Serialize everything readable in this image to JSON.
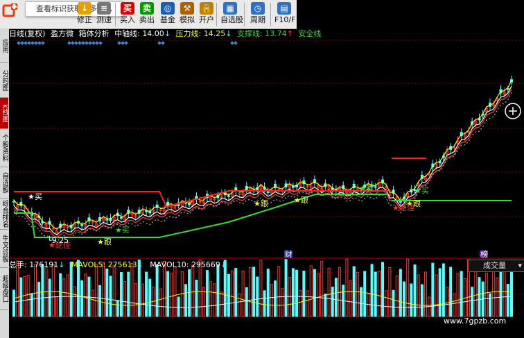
{
  "toolbar": {
    "tooltip": "查看标识获取更多信息",
    "buttons": [
      {
        "label": "修正",
        "icon": "↓",
        "color": "#e8a000"
      },
      {
        "label": "测速",
        "icon": "≡",
        "color": "#777"
      },
      {
        "label": "买入",
        "icon": "买",
        "color": "#d00"
      },
      {
        "label": "卖出",
        "icon": "卖",
        "color": "#090"
      },
      {
        "label": "基金",
        "icon": "◎",
        "color": "#1a5fb0"
      },
      {
        "label": "模拟",
        "icon": "⚒",
        "color": "#b06000"
      },
      {
        "label": "开户",
        "icon": "🔒",
        "color": "#c08000"
      },
      {
        "label": "自选股",
        "icon": "▦",
        "color": "#3070c0"
      },
      {
        "label": "周期",
        "icon": "◷",
        "color": "#3070c0"
      },
      {
        "label": "F10/F",
        "icon": "▤",
        "color": "#3070c0"
      }
    ]
  },
  "sidetabs": [
    {
      "label": "应用"
    },
    {
      "label": "分时图"
    },
    {
      "label": "K线图",
      "active": true
    },
    {
      "label": "个股资料"
    },
    {
      "label": "自选股"
    },
    {
      "label": "综合排名"
    },
    {
      "label": "牛叉诊股"
    },
    {
      "label": "超级盘口"
    }
  ],
  "infobar": {
    "period": "日线(复权)",
    "indicator": "盈方微",
    "box": "箱体分析",
    "mid_label": "中轴线:",
    "mid_value": "14.00",
    "press_label": "压力线:",
    "press_value": "14.25",
    "support_label": "支撑线:",
    "support_value": "13.74",
    "safe_label": "安全线"
  },
  "chart_labels": {
    "buy1": "买",
    "follow1": "跟",
    "buy2": "买",
    "follow2": "跟",
    "follow3": "跟",
    "buy3": "买",
    "buy4": "买",
    "follow4": "跟",
    "bottom1": "绝佳",
    "bottom2": "绝佳",
    "low_price": "9.25",
    "news_cai": "财",
    "news_bang": "榜"
  },
  "volbar": {
    "total_label": "总手:",
    "total_value": "176191",
    "ma5_label": "MAVOL5:",
    "ma5_value": "275613",
    "ma10_label": "MAVOL10:",
    "ma10_value": "295669",
    "select_value": "成交量"
  },
  "watermark": "www.7gpzb.com",
  "colors": {
    "up": "#ff3232",
    "down": "#54ffff",
    "pressure": "#ff2020",
    "support": "#33dd33",
    "ma_white": "#ffffff",
    "ma_yellow": "#ffff00",
    "dotted": "#66cccc"
  }
}
